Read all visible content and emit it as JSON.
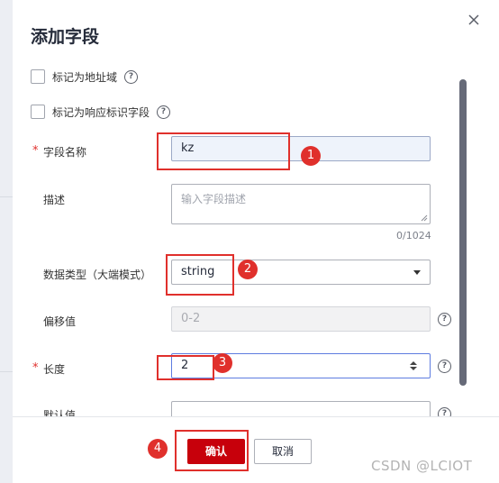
{
  "dialog": {
    "title": "添加字段",
    "checkboxes": [
      {
        "label": "标记为地址域",
        "checked": false
      },
      {
        "label": "标记为响应标识字段",
        "checked": false
      }
    ],
    "fields": {
      "name": {
        "label": "字段名称",
        "required": true,
        "value": "kz"
      },
      "description": {
        "label": "描述",
        "placeholder": "输入字段描述",
        "counter": "0/1024"
      },
      "data_type": {
        "label": "数据类型（大端模式）",
        "value": "string"
      },
      "offset": {
        "label": "偏移值",
        "value": "0-2"
      },
      "length": {
        "label": "长度",
        "required": true,
        "value": "2"
      },
      "default": {
        "label": "默认值"
      }
    },
    "required_mark": "*",
    "confirm_label": "确认",
    "cancel_label": "取消"
  },
  "annotations": [
    "1",
    "2",
    "3",
    "4"
  ],
  "watermark": "CSDN @LCIOT",
  "colors": {
    "accent_red": "#c7000b",
    "annotation_red": "#e0302c",
    "focus_blue": "#5e7ce0"
  }
}
